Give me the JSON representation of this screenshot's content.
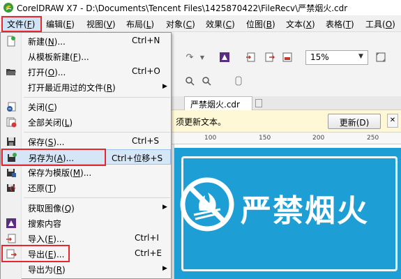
{
  "window": {
    "title": "CorelDRAW X7 - D:\\Documents\\Tencent Files\\1425870422\\FileRecv\\严禁烟火.cdr"
  },
  "menubar": {
    "items": [
      {
        "label": "文件",
        "key": "F"
      },
      {
        "label": "编辑",
        "key": "E"
      },
      {
        "label": "视图",
        "key": "V"
      },
      {
        "label": "布局",
        "key": "L"
      },
      {
        "label": "对象",
        "key": "C"
      },
      {
        "label": "效果",
        "key": "C"
      },
      {
        "label": "位图",
        "key": "B"
      },
      {
        "label": "文本",
        "key": "X"
      },
      {
        "label": "表格",
        "key": "T"
      },
      {
        "label": "工具",
        "key": "O"
      }
    ]
  },
  "toolbar": {
    "zoom": "15%"
  },
  "document": {
    "tab_label": "严禁烟火.cdr",
    "info_text": "须更新文本。",
    "update_button": "更新(D)",
    "ruler_labels": [
      "100",
      "150",
      "200",
      "250"
    ],
    "sign_text": "严禁烟火",
    "sign_color": "#1d9fd5"
  },
  "file_menu": {
    "items": [
      {
        "label": "新建(",
        "key": "N",
        "tail": ")...",
        "shortcut": "Ctrl+N",
        "icon": "new-document-icon"
      },
      {
        "label": "从模板新建(",
        "key": "F",
        "tail": ")...",
        "shortcut": "",
        "icon": "none"
      },
      {
        "label": "打开(",
        "key": "O",
        "tail": ")...",
        "shortcut": "Ctrl+O",
        "icon": "open-folder-icon"
      },
      {
        "label": "打开最近用过的文件(",
        "key": "R",
        "tail": ")",
        "shortcut": "",
        "icon": "none",
        "submenu": true
      },
      {
        "label": "关闭(",
        "key": "C",
        "tail": ")",
        "shortcut": "",
        "icon": "close-document-icon"
      },
      {
        "label": "全部关闭(",
        "key": "L",
        "tail": ")",
        "shortcut": "",
        "icon": "close-all-icon"
      },
      {
        "label": "保存(",
        "key": "S",
        "tail": ")...",
        "shortcut": "Ctrl+S",
        "icon": "save-icon"
      },
      {
        "label": "另存为(",
        "key": "A",
        "tail": ")...",
        "shortcut": "Ctrl+位移+S",
        "icon": "save-as-icon"
      },
      {
        "label": "保存为模版(",
        "key": "M",
        "tail": ")...",
        "shortcut": "",
        "icon": "save-template-icon"
      },
      {
        "label": "还原(",
        "key": "T",
        "tail": ")",
        "shortcut": "",
        "icon": "revert-icon"
      },
      {
        "label": "获取图像(",
        "key": "Q",
        "tail": ")",
        "shortcut": "",
        "icon": "none",
        "submenu": true
      },
      {
        "label": "搜索内容",
        "key": "",
        "tail": "",
        "shortcut": "",
        "icon": "search-content-icon"
      },
      {
        "label": "导入(",
        "key": "E",
        "tail": ")...",
        "shortcut": "Ctrl+I",
        "icon": "import-icon"
      },
      {
        "label": "导出(",
        "key": "E",
        "tail": ")...",
        "shortcut": "Ctrl+E",
        "icon": "export-icon"
      },
      {
        "label": "导出为(",
        "key": "R",
        "tail": ")",
        "shortcut": "",
        "icon": "none",
        "submenu": true
      }
    ]
  },
  "colors": {
    "annotation": "#e8262f",
    "highlight": "#d5e6f7",
    "sign_blue": "#1d9fd5"
  }
}
